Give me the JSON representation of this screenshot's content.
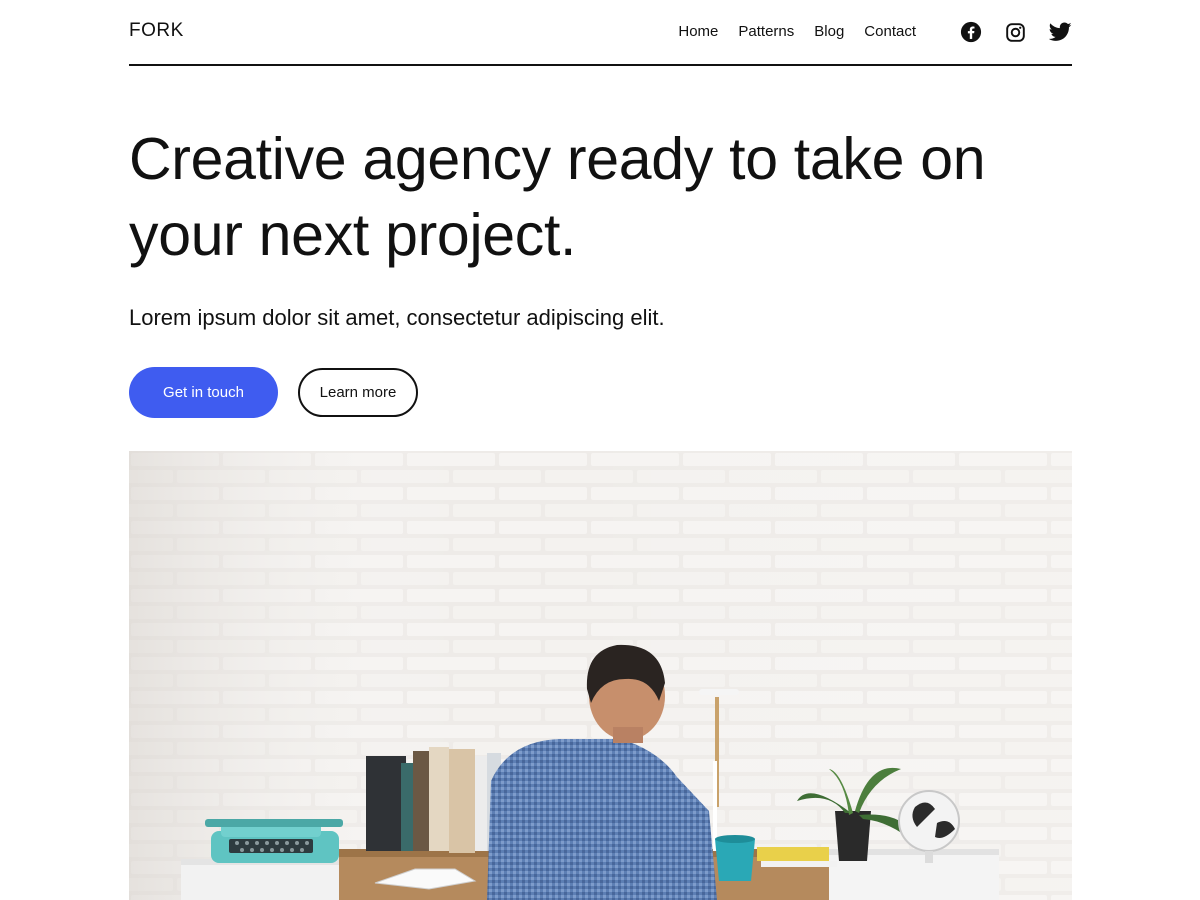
{
  "header": {
    "logo": "FORK",
    "nav": [
      "Home",
      "Patterns",
      "Blog",
      "Contact"
    ],
    "social_icons": [
      "facebook-icon",
      "instagram-icon",
      "twitter-icon"
    ]
  },
  "hero": {
    "title": "Creative agency ready to take on your next project.",
    "subtitle": "Lorem ipsum dolor sit amet, consectetur adipiscing elit.",
    "primary_button": "Get in touch",
    "secondary_button": "Learn more"
  },
  "colors": {
    "accent": "#3f5cf0",
    "text": "#111111",
    "background": "#ffffff"
  }
}
